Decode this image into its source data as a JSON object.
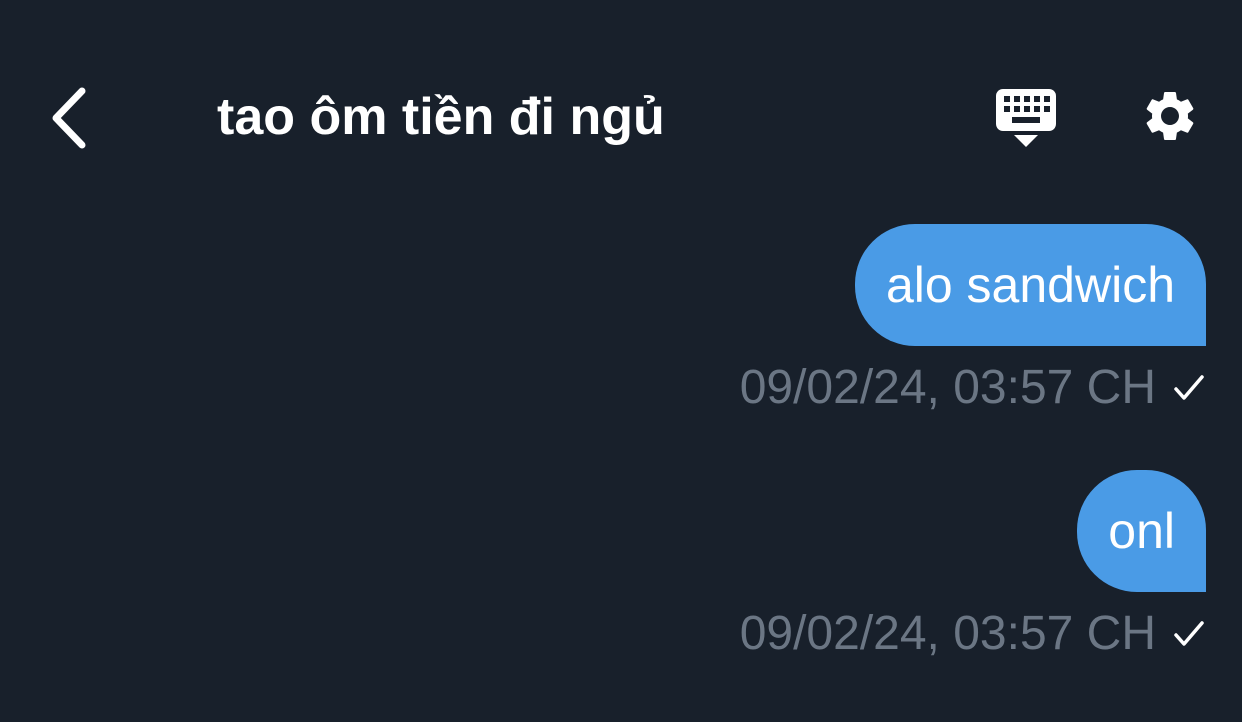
{
  "header": {
    "title": "tao ôm tiền đi ngủ",
    "back_icon": "chevron-left-icon",
    "keyboard_icon": "keyboard-hide-icon",
    "settings_icon": "gear-icon"
  },
  "messages": [
    {
      "text": "alo sandwich",
      "timestamp": "09/02/24, 03:57 CH",
      "status_icon": "check-icon"
    },
    {
      "text": "onl",
      "timestamp": "09/02/24, 03:57 CH",
      "status_icon": "check-icon"
    }
  ],
  "colors": {
    "background": "#18202b",
    "bubble": "#4a9be6",
    "timestamp": "#6b7684",
    "text": "#ffffff"
  }
}
